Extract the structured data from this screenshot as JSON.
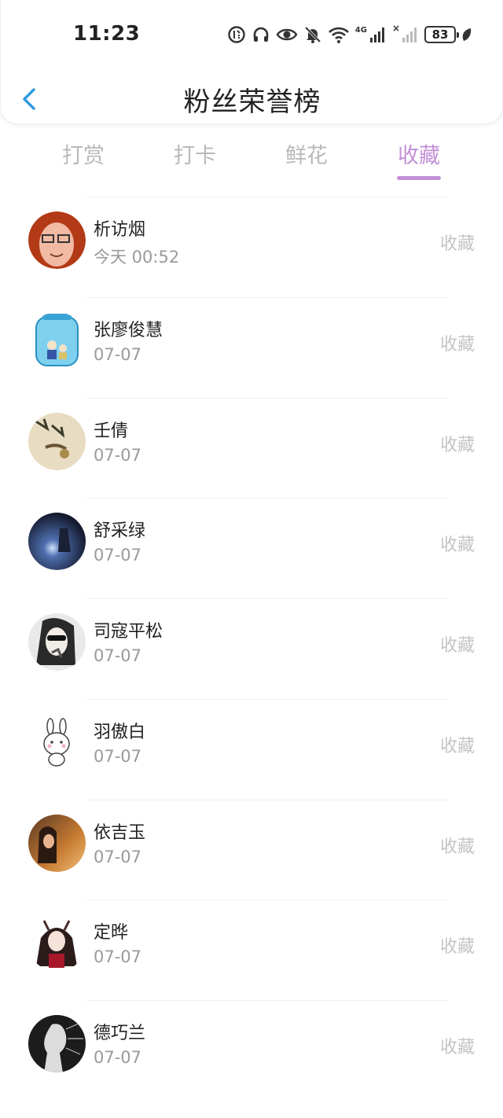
{
  "status_bar": {
    "time": "11:23",
    "network": "4G",
    "battery": "83"
  },
  "header": {
    "title": "粉丝荣誉榜"
  },
  "tabs": [
    {
      "label": "打赏",
      "active": false
    },
    {
      "label": "打卡",
      "active": false
    },
    {
      "label": "鲜花",
      "active": false
    },
    {
      "label": "收藏",
      "active": true
    }
  ],
  "colors": {
    "accent": "#c48fd8",
    "muted": "#c4c4c4",
    "sub_text": "#9a9a9a",
    "back_arrow": "#2f9ae0"
  },
  "fans": [
    {
      "name": "析访烟",
      "time": "今天 00:52",
      "action": "收藏"
    },
    {
      "name": "张廖俊慧",
      "time": "07-07",
      "action": "收藏"
    },
    {
      "name": "壬倩",
      "time": "07-07",
      "action": "收藏"
    },
    {
      "name": "舒采绿",
      "time": "07-07",
      "action": "收藏"
    },
    {
      "name": "司寇平松",
      "time": "07-07",
      "action": "收藏"
    },
    {
      "name": "羽傲白",
      "time": "07-07",
      "action": "收藏"
    },
    {
      "name": "依吉玉",
      "time": "07-07",
      "action": "收藏"
    },
    {
      "name": "定晔",
      "time": "07-07",
      "action": "收藏"
    },
    {
      "name": "德巧兰",
      "time": "07-07",
      "action": "收藏"
    }
  ]
}
